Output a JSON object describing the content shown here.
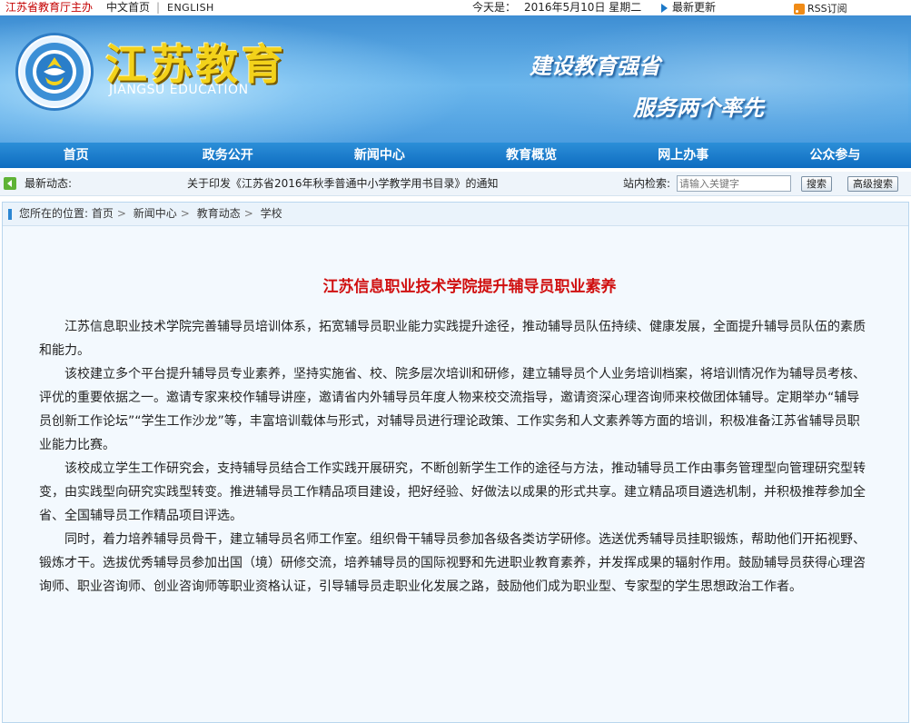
{
  "topbar": {
    "host": "江苏省教育厅主办",
    "home": "中文首页",
    "separator": "|",
    "english": "ENGLISH",
    "today_label": "今天是：",
    "date": "2016年5月10日 星期二",
    "latest": "最新更新",
    "rss": "RSS订阅"
  },
  "banner": {
    "cn_title": "江苏教育",
    "en_title": "JIANGSU EDUCATION",
    "slogan1": "建设教育强省",
    "slogan2": "服务两个率先"
  },
  "nav": {
    "items": [
      "首页",
      "政务公开",
      "新闻中心",
      "教育概览",
      "网上办事",
      "公众参与"
    ]
  },
  "news": {
    "label": "最新动态:",
    "headline": "关于印发《江苏省2016年秋季普通中小学教学用书目录》的通知",
    "search_label": "站内检索:",
    "search_placeholder": "请输入关键字",
    "search_button": "搜索",
    "advanced_button": "高级搜索"
  },
  "breadcrumb": {
    "prefix": "您所在的位置:",
    "items": [
      "首页",
      "新闻中心",
      "教育动态",
      "学校"
    ]
  },
  "article": {
    "title": "江苏信息职业技术学院提升辅导员职业素养",
    "paragraphs": [
      "江苏信息职业技术学院完善辅导员培训体系，拓宽辅导员职业能力实践提升途径，推动辅导员队伍持续、健康发展，全面提升辅导员队伍的素质和能力。",
      "该校建立多个平台提升辅导员专业素养，坚持实施省、校、院多层次培训和研修，建立辅导员个人业务培训档案，将培训情况作为辅导员考核、评优的重要依据之一。邀请专家来校作辅导讲座，邀请省内外辅导员年度人物来校交流指导，邀请资深心理咨询师来校做团体辅导。定期举办“辅导员创新工作论坛”“学生工作沙龙”等，丰富培训载体与形式，对辅导员进行理论政策、工作实务和人文素养等方面的培训，积极准备江苏省辅导员职业能力比赛。",
      "该校成立学生工作研究会，支持辅导员结合工作实践开展研究，不断创新学生工作的途径与方法，推动辅导员工作由事务管理型向管理研究型转变，由实践型向研究实践型转变。推进辅导员工作精品项目建设，把好经验、好做法以成果的形式共享。建立精品项目遴选机制，并积极推荐参加全省、全国辅导员工作精品项目评选。",
      "同时，着力培养辅导员骨干，建立辅导员名师工作室。组织骨干辅导员参加各级各类访学研修。选送优秀辅导员挂职锻炼，帮助他们开拓视野、锻炼才干。选拔优秀辅导员参加出国（境）研修交流，培养辅导员的国际视野和先进职业教育素养，并发挥成果的辐射作用。鼓励辅导员获得心理咨询师、职业咨询师、创业咨询师等职业资格认证，引导辅导员走职业化发展之路，鼓励他们成为职业型、专家型的学生思想政治工作者。"
    ]
  }
}
